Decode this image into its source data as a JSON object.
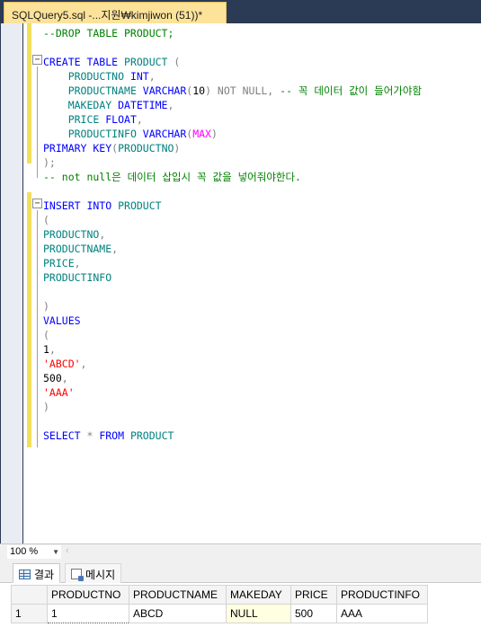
{
  "tab": {
    "title": "SQLQuery5.sql -...지원₩kimjiwon (51))*"
  },
  "editor": {
    "lines": [
      [
        [
          "cm",
          "--DROP TABLE PRODUCT;"
        ]
      ],
      [],
      [
        [
          "kw",
          "CREATE TABLE "
        ],
        [
          "id",
          "PRODUCT "
        ],
        [
          "gy",
          "("
        ]
      ],
      [
        [
          "tx",
          "    "
        ],
        [
          "id",
          "PRODUCTNO "
        ],
        [
          "kw",
          "INT"
        ],
        [
          "gy",
          ","
        ]
      ],
      [
        [
          "tx",
          "    "
        ],
        [
          "id",
          "PRODUCTNAME "
        ],
        [
          "kw",
          "VARCHAR"
        ],
        [
          "gy",
          "("
        ],
        [
          "tx",
          "10"
        ],
        [
          "gy",
          ") NOT NULL, "
        ],
        [
          "cm",
          "-- 꼭 데이터 값이 들어가야함"
        ]
      ],
      [
        [
          "tx",
          "    "
        ],
        [
          "id",
          "MAKEDAY "
        ],
        [
          "kw",
          "DATETIME"
        ],
        [
          "gy",
          ","
        ]
      ],
      [
        [
          "tx",
          "    "
        ],
        [
          "id",
          "PRICE "
        ],
        [
          "kw",
          "FLOAT"
        ],
        [
          "gy",
          ","
        ]
      ],
      [
        [
          "tx",
          "    "
        ],
        [
          "id",
          "PRODUCTINFO "
        ],
        [
          "kw",
          "VARCHAR"
        ],
        [
          "gy",
          "("
        ],
        [
          "fn",
          "MAX"
        ],
        [
          "gy",
          ")"
        ]
      ],
      [
        [
          "kw",
          "PRIMARY KEY"
        ],
        [
          "gy",
          "("
        ],
        [
          "id",
          "PRODUCTNO"
        ],
        [
          "gy",
          ")"
        ]
      ],
      [
        [
          "gy",
          ");"
        ]
      ],
      [
        [
          "cm",
          "-- not null은 데이터 삽입시 꼭 값을 넣어줘야한다."
        ]
      ],
      [],
      [
        [
          "kw",
          "INSERT INTO "
        ],
        [
          "id",
          "PRODUCT"
        ]
      ],
      [
        [
          "gy",
          "("
        ]
      ],
      [
        [
          "id",
          "PRODUCTNO"
        ],
        [
          "gy",
          ","
        ]
      ],
      [
        [
          "id",
          "PRODUCTNAME"
        ],
        [
          "gy",
          ","
        ]
      ],
      [
        [
          "id",
          "PRICE"
        ],
        [
          "gy",
          ","
        ]
      ],
      [
        [
          "id",
          "PRODUCTINFO"
        ]
      ],
      [],
      [
        [
          "gy",
          ")"
        ]
      ],
      [
        [
          "kw",
          "VALUES"
        ]
      ],
      [
        [
          "gy",
          "("
        ]
      ],
      [
        [
          "tx",
          "1"
        ],
        [
          "gy",
          ","
        ]
      ],
      [
        [
          "str",
          "'ABCD'"
        ],
        [
          "gy",
          ","
        ]
      ],
      [
        [
          "tx",
          "500"
        ],
        [
          "gy",
          ","
        ]
      ],
      [
        [
          "str",
          "'AAA'"
        ]
      ],
      [
        [
          "gy",
          ")"
        ]
      ],
      [],
      [
        [
          "kw",
          "SELECT "
        ],
        [
          "gy",
          "* "
        ],
        [
          "kw",
          "FROM "
        ],
        [
          "id",
          "PRODUCT"
        ]
      ]
    ]
  },
  "zoom": {
    "value": "100 %"
  },
  "result_tabs": {
    "results": "결과",
    "messages": "메시지"
  },
  "grid": {
    "columns": [
      "PRODUCTNO",
      "PRODUCTNAME",
      "MAKEDAY",
      "PRICE",
      "PRODUCTINFO"
    ],
    "rows": [
      {
        "rownum": "1",
        "cells": [
          "1",
          "ABCD",
          "NULL",
          "500",
          "AAA"
        ]
      }
    ]
  }
}
